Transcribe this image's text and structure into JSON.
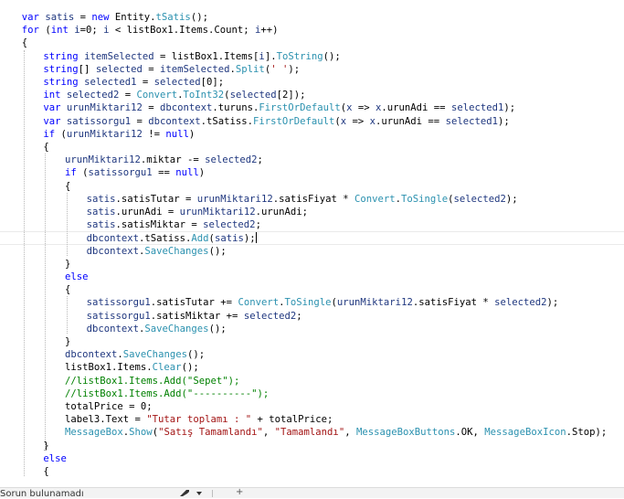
{
  "editor": {
    "colors": {
      "keyword": "#0000ff",
      "type": "#2b91af",
      "string": "#a31515",
      "comment": "#008000",
      "identifier": "#1f377f",
      "plain": "#000000"
    },
    "lines": [
      {
        "indent": 2,
        "tokens": [
          [
            "kw",
            "var"
          ],
          [
            "p",
            " "
          ],
          [
            "id",
            "satis"
          ],
          [
            "p",
            " = "
          ],
          [
            "kw",
            "new"
          ],
          [
            "p",
            " Entity."
          ],
          [
            "type",
            "tSatis"
          ],
          [
            "p",
            "();"
          ]
        ]
      },
      {
        "indent": 2,
        "tokens": [
          [
            "kw",
            "for"
          ],
          [
            "p",
            " ("
          ],
          [
            "kw",
            "int"
          ],
          [
            "p",
            " "
          ],
          [
            "id",
            "i"
          ],
          [
            "p",
            "=0; "
          ],
          [
            "id",
            "i"
          ],
          [
            "p",
            " < listBox1.Items.Count; "
          ],
          [
            "id",
            "i"
          ],
          [
            "p",
            "++)"
          ]
        ]
      },
      {
        "indent": 2,
        "tokens": [
          [
            "p",
            "{"
          ]
        ]
      },
      {
        "indent": 6,
        "tokens": [
          [
            "kw",
            "string"
          ],
          [
            "p",
            " "
          ],
          [
            "id",
            "itemSelected"
          ],
          [
            "p",
            " = listBox1.Items["
          ],
          [
            "id",
            "i"
          ],
          [
            "p",
            "]."
          ],
          [
            "type",
            "ToString"
          ],
          [
            "p",
            "();"
          ]
        ]
      },
      {
        "indent": 6,
        "tokens": [
          [
            "kw",
            "string"
          ],
          [
            "p",
            "[] "
          ],
          [
            "id",
            "selected"
          ],
          [
            "p",
            " = "
          ],
          [
            "id",
            "itemSelected"
          ],
          [
            "p",
            "."
          ],
          [
            "type",
            "Split"
          ],
          [
            "p",
            "("
          ],
          [
            "str",
            "' '"
          ],
          [
            "p",
            ");"
          ]
        ]
      },
      {
        "indent": 6,
        "tokens": [
          [
            "kw",
            "string"
          ],
          [
            "p",
            " "
          ],
          [
            "id",
            "selected1"
          ],
          [
            "p",
            " = "
          ],
          [
            "id",
            "selected"
          ],
          [
            "p",
            "[0];"
          ]
        ]
      },
      {
        "indent": 6,
        "tokens": [
          [
            "kw",
            "int"
          ],
          [
            "p",
            " "
          ],
          [
            "id",
            "selected2"
          ],
          [
            "p",
            " = "
          ],
          [
            "type",
            "Convert"
          ],
          [
            "p",
            "."
          ],
          [
            "type",
            "ToInt32"
          ],
          [
            "p",
            "("
          ],
          [
            "id",
            "selected"
          ],
          [
            "p",
            "[2]);"
          ]
        ]
      },
      {
        "indent": 6,
        "tokens": [
          [
            "kw",
            "var"
          ],
          [
            "p",
            " "
          ],
          [
            "id",
            "urunMiktari12"
          ],
          [
            "p",
            " = "
          ],
          [
            "id",
            "dbcontext"
          ],
          [
            "p",
            ".turuns."
          ],
          [
            "type",
            "FirstOrDefault"
          ],
          [
            "p",
            "("
          ],
          [
            "id",
            "x"
          ],
          [
            "p",
            " => "
          ],
          [
            "id",
            "x"
          ],
          [
            "p",
            ".urunAdi == "
          ],
          [
            "id",
            "selected1"
          ],
          [
            "p",
            ");"
          ]
        ]
      },
      {
        "indent": 6,
        "tokens": [
          [
            "kw",
            "var"
          ],
          [
            "p",
            " "
          ],
          [
            "id",
            "satissorgu1"
          ],
          [
            "p",
            " = "
          ],
          [
            "id",
            "dbcontext"
          ],
          [
            "p",
            ".tSatiss."
          ],
          [
            "type",
            "FirstOrDefault"
          ],
          [
            "p",
            "("
          ],
          [
            "id",
            "x"
          ],
          [
            "p",
            " => "
          ],
          [
            "id",
            "x"
          ],
          [
            "p",
            ".urunAdi == "
          ],
          [
            "id",
            "selected1"
          ],
          [
            "p",
            ");"
          ]
        ]
      },
      {
        "indent": 6,
        "tokens": [
          [
            "kw",
            "if"
          ],
          [
            "p",
            " ("
          ],
          [
            "id",
            "urunMiktari12"
          ],
          [
            "p",
            " != "
          ],
          [
            "kw",
            "null"
          ],
          [
            "p",
            ")"
          ]
        ]
      },
      {
        "indent": 6,
        "tokens": [
          [
            "p",
            "{"
          ]
        ]
      },
      {
        "indent": 10,
        "tokens": [
          [
            "id",
            "urunMiktari12"
          ],
          [
            "p",
            ".miktar -= "
          ],
          [
            "id",
            "selected2"
          ],
          [
            "p",
            ";"
          ]
        ]
      },
      {
        "indent": 10,
        "tokens": [
          [
            "kw",
            "if"
          ],
          [
            "p",
            " ("
          ],
          [
            "id",
            "satissorgu1"
          ],
          [
            "p",
            " == "
          ],
          [
            "kw",
            "null"
          ],
          [
            "p",
            ")"
          ]
        ]
      },
      {
        "indent": 10,
        "tokens": [
          [
            "p",
            "{"
          ]
        ]
      },
      {
        "indent": 14,
        "tokens": [
          [
            "id",
            "satis"
          ],
          [
            "p",
            ".satisTutar = "
          ],
          [
            "id",
            "urunMiktari12"
          ],
          [
            "p",
            ".satisFiyat * "
          ],
          [
            "type",
            "Convert"
          ],
          [
            "p",
            "."
          ],
          [
            "type",
            "ToSingle"
          ],
          [
            "p",
            "("
          ],
          [
            "id",
            "selected2"
          ],
          [
            "p",
            ");"
          ]
        ]
      },
      {
        "indent": 14,
        "tokens": [
          [
            "id",
            "satis"
          ],
          [
            "p",
            ".urunAdi = "
          ],
          [
            "id",
            "urunMiktari12"
          ],
          [
            "p",
            ".urunAdi;"
          ]
        ]
      },
      {
        "indent": 14,
        "tokens": [
          [
            "id",
            "satis"
          ],
          [
            "p",
            ".satisMiktar = "
          ],
          [
            "id",
            "selected2"
          ],
          [
            "p",
            ";"
          ]
        ]
      },
      {
        "indent": 14,
        "current": true,
        "tokens": [
          [
            "id",
            "dbcontext"
          ],
          [
            "p",
            ".tSatiss."
          ],
          [
            "type",
            "Add"
          ],
          [
            "p",
            "("
          ],
          [
            "id",
            "satis"
          ],
          [
            "p",
            ");"
          ]
        ]
      },
      {
        "indent": 14,
        "tokens": [
          [
            "id",
            "dbcontext"
          ],
          [
            "p",
            "."
          ],
          [
            "type",
            "SaveChanges"
          ],
          [
            "p",
            "();"
          ]
        ]
      },
      {
        "indent": 10,
        "tokens": [
          [
            "p",
            "}"
          ]
        ]
      },
      {
        "indent": 10,
        "tokens": [
          [
            "kw",
            "else"
          ]
        ]
      },
      {
        "indent": 10,
        "tokens": [
          [
            "p",
            "{"
          ]
        ]
      },
      {
        "indent": 14,
        "tokens": [
          [
            "id",
            "satissorgu1"
          ],
          [
            "p",
            ".satisTutar += "
          ],
          [
            "type",
            "Convert"
          ],
          [
            "p",
            "."
          ],
          [
            "type",
            "ToSingle"
          ],
          [
            "p",
            "("
          ],
          [
            "id",
            "urunMiktari12"
          ],
          [
            "p",
            ".satisFiyat * "
          ],
          [
            "id",
            "selected2"
          ],
          [
            "p",
            ");"
          ]
        ]
      },
      {
        "indent": 14,
        "tokens": [
          [
            "id",
            "satissorgu1"
          ],
          [
            "p",
            ".satisMiktar += "
          ],
          [
            "id",
            "selected2"
          ],
          [
            "p",
            ";"
          ]
        ]
      },
      {
        "indent": 14,
        "tokens": [
          [
            "id",
            "dbcontext"
          ],
          [
            "p",
            "."
          ],
          [
            "type",
            "SaveChanges"
          ],
          [
            "p",
            "();"
          ]
        ]
      },
      {
        "indent": 10,
        "tokens": [
          [
            "p",
            "}"
          ]
        ]
      },
      {
        "indent": 10,
        "tokens": [
          [
            "id",
            "dbcontext"
          ],
          [
            "p",
            "."
          ],
          [
            "type",
            "SaveChanges"
          ],
          [
            "p",
            "();"
          ]
        ]
      },
      {
        "indent": 10,
        "tokens": [
          [
            "p",
            "listBox1.Items."
          ],
          [
            "type",
            "Clear"
          ],
          [
            "p",
            "();"
          ]
        ]
      },
      {
        "indent": 10,
        "tokens": [
          [
            "cm",
            "//listBox1.Items.Add(\"Sepet\");"
          ]
        ]
      },
      {
        "indent": 10,
        "tokens": [
          [
            "cm",
            "//listBox1.Items.Add(\"----------\");"
          ]
        ]
      },
      {
        "indent": 10,
        "tokens": [
          [
            "p",
            "totalPrice = 0;"
          ]
        ]
      },
      {
        "indent": 10,
        "tokens": [
          [
            "p",
            "label3.Text = "
          ],
          [
            "str",
            "\"Tutar toplamı : \""
          ],
          [
            "p",
            " + totalPrice;"
          ]
        ]
      },
      {
        "indent": 10,
        "tokens": [
          [
            "type",
            "MessageBox"
          ],
          [
            "p",
            "."
          ],
          [
            "type",
            "Show"
          ],
          [
            "p",
            "("
          ],
          [
            "str",
            "\"Satış Tamamlandı\""
          ],
          [
            "p",
            ", "
          ],
          [
            "str",
            "\"Tamamlandı\""
          ],
          [
            "p",
            ", "
          ],
          [
            "type",
            "MessageBoxButtons"
          ],
          [
            "p",
            ".OK, "
          ],
          [
            "type",
            "MessageBoxIcon"
          ],
          [
            "p",
            ".Stop);"
          ]
        ]
      },
      {
        "indent": 6,
        "tokens": [
          [
            "p",
            "}"
          ]
        ]
      },
      {
        "indent": 6,
        "tokens": [
          [
            "kw",
            "else"
          ]
        ]
      },
      {
        "indent": 6,
        "tokens": [
          [
            "p",
            "{"
          ]
        ]
      }
    ]
  },
  "statusbar": {
    "message": "Sorun bulunamadı",
    "icons": [
      "tool-icon",
      "chevron-down-icon",
      "plus-icon"
    ]
  }
}
